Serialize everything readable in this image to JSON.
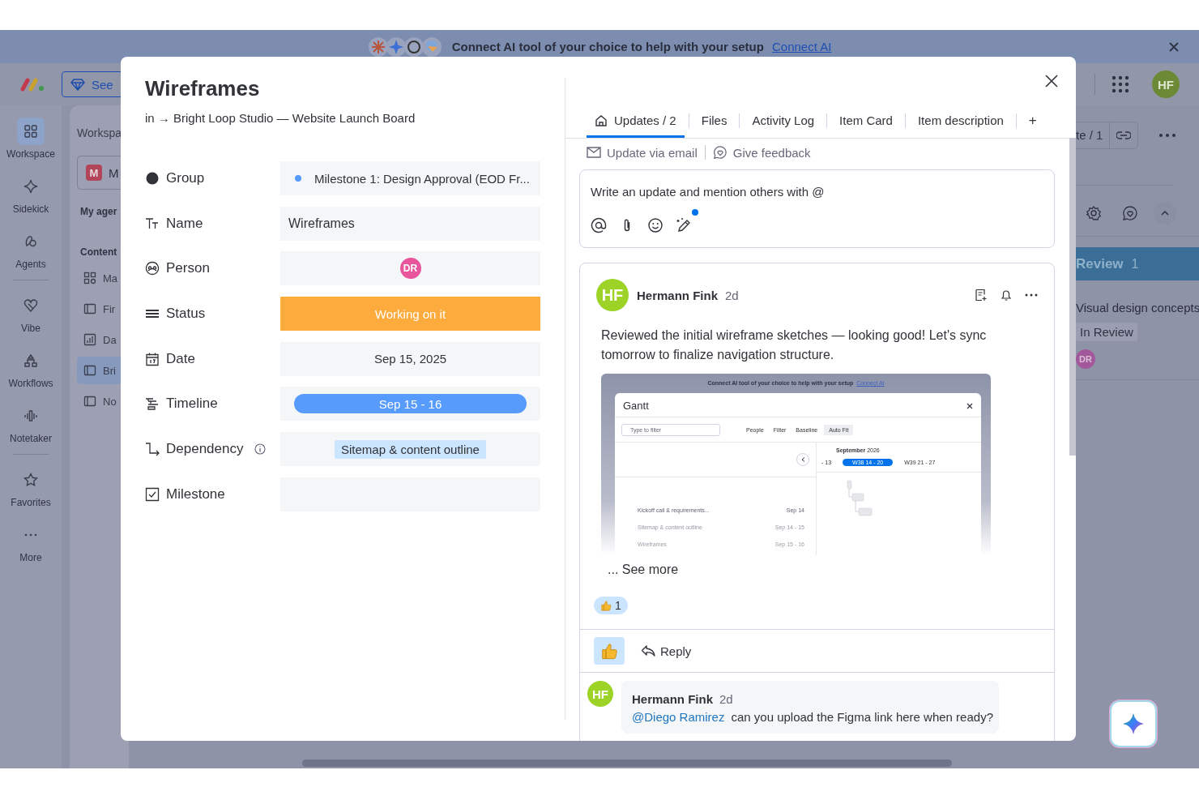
{
  "banner": {
    "text": "Connect AI tool of your choice to help with your setup",
    "link": "Connect AI"
  },
  "topbar": {
    "upgrade_button": "See",
    "avatar": "HF"
  },
  "rail_groups": [
    {
      "items": [
        {
          "label": "Workspace",
          "kind": "workspace",
          "selected": true
        },
        {
          "label": "Sidekick",
          "kind": "sidekick",
          "selected": false
        },
        {
          "label": "Agents",
          "kind": "agents",
          "selected": false
        }
      ]
    },
    {
      "items": [
        {
          "label": "Vibe",
          "kind": "vibe",
          "selected": false
        },
        {
          "label": "Workflows",
          "kind": "workflows",
          "selected": false
        },
        {
          "label": "Notetaker",
          "kind": "notetaker",
          "selected": false
        }
      ]
    },
    {
      "items": [
        {
          "label": "Favorites",
          "kind": "favorites",
          "selected": false
        },
        {
          "label": "More",
          "kind": "more",
          "selected": false
        }
      ]
    }
  ],
  "workspace_panel": {
    "title": "Workspa",
    "workspace": {
      "initial": "M",
      "name": "M"
    },
    "agents_heading": "My ager",
    "content_heading": "Content",
    "items": [
      {
        "label": "Ma",
        "kind": "dashboard",
        "selected": false
      },
      {
        "label": "Fir",
        "kind": "board",
        "selected": false
      },
      {
        "label": "Da",
        "kind": "chart",
        "selected": false
      },
      {
        "label": "Bri",
        "kind": "board",
        "selected": true
      },
      {
        "label": "No",
        "kind": "board",
        "selected": false
      }
    ]
  },
  "board": {
    "share_button": "te / 1",
    "group": {
      "title": "Review",
      "count": "1"
    },
    "item": {
      "name": "Visual design concepts",
      "status": "In Review",
      "person": "DR"
    }
  },
  "modal": {
    "title": "Wireframes",
    "breadcrumb": "in → Bright Loop Studio — Website Launch Board",
    "fields": [
      {
        "label": "Group",
        "kind": "group",
        "value": "Milestone 1: Design Approval (EOD Fr...",
        "color": "#579bfc"
      },
      {
        "label": "Name",
        "kind": "text",
        "value": "Wireframes"
      },
      {
        "label": "Person",
        "kind": "person",
        "value": "DR"
      },
      {
        "label": "Status",
        "kind": "status",
        "value": "Working on it",
        "color": "#fdab3d"
      },
      {
        "label": "Date",
        "kind": "date",
        "value": "Sep 15, 2025"
      },
      {
        "label": "Timeline",
        "kind": "timeline",
        "value": "Sep 15 - 16"
      },
      {
        "label": "Dependency",
        "kind": "dependency",
        "value": "Sitemap & content outline",
        "info": true
      },
      {
        "label": "Milestone",
        "kind": "milestone"
      }
    ],
    "tabs": [
      {
        "label": "Updates / 2",
        "selected": true
      },
      {
        "label": "Files",
        "selected": false
      },
      {
        "label": "Activity Log",
        "selected": false
      },
      {
        "label": "Item Card",
        "selected": false
      },
      {
        "label": "Item description",
        "selected": false
      }
    ],
    "add_tab": "+",
    "actions": [
      {
        "label": "Update via email",
        "kind": "email"
      },
      {
        "label": "Give feedback",
        "kind": "feedback"
      }
    ],
    "editor": {
      "placeholder": "Write an update and mention others with @"
    },
    "post": {
      "avatar": "HF",
      "author": "Hermann Fink",
      "time": "2d",
      "text": "Reviewed the initial wireframe sketches — looking good! Let's sync tomorrow to finalize navigation structure.",
      "attachment": {
        "banner": "Connect AI tool of your choice to help with your setup",
        "banner_link": "Connect AI",
        "title": "Gantt",
        "filter_placeholder": "Type to filter",
        "toolbar": [
          {
            "label": "People",
            "kind": "people"
          },
          {
            "label": "Filter",
            "kind": "filter"
          },
          {
            "label": "Baseline",
            "kind": "baseline"
          },
          {
            "label": "Auto Fit",
            "kind": "autofit"
          }
        ],
        "month": "**September** 2026",
        "weeks": [
          {
            "label": "- 13",
            "selected": false
          },
          {
            "label": "W38 14 - 20",
            "selected": true
          },
          {
            "label": "W39 21 - 27",
            "selected": false
          }
        ],
        "rows": [
          {
            "name": "Kickoff call & requirements...",
            "dates": "Sep 14"
          },
          {
            "name": "Sitemap & content outline",
            "dates": "Sep 14 - 15"
          },
          {
            "name": "Wireframes",
            "dates": "Sep 15 - 16"
          }
        ]
      },
      "see_more": "... See more",
      "reaction_count": "1",
      "reply_button": "Reply"
    },
    "reply": {
      "avatar": "HF",
      "author": "Hermann Fink",
      "time": "2d",
      "mention": "@Diego Ramirez",
      "text": "can you upload the Figma link here when ready?"
    }
  }
}
